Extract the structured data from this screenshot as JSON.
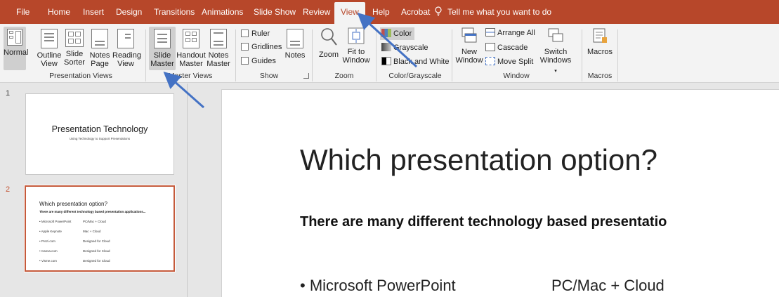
{
  "colors": {
    "accent": "#b7472a",
    "arrow": "#4472c4",
    "selection": "#c55a3b"
  },
  "menu": {
    "tabs": [
      "File",
      "Home",
      "Insert",
      "Design",
      "Transitions",
      "Animations",
      "Slide Show",
      "Review",
      "View",
      "Help",
      "Acrobat"
    ],
    "active_tab": "View",
    "tell_me": "Tell me what you want to do"
  },
  "ribbon": {
    "presentation_views": {
      "label": "Presentation Views",
      "normal": "Normal",
      "outline": [
        "Outline",
        "View"
      ],
      "sorter": [
        "Slide",
        "Sorter"
      ],
      "notes_page": [
        "Notes",
        "Page"
      ],
      "reading": [
        "Reading",
        "View"
      ]
    },
    "master_views": {
      "label": "Master Views",
      "slide_master": [
        "Slide",
        "Master"
      ],
      "handout_master": [
        "Handout",
        "Master"
      ],
      "notes_master": [
        "Notes",
        "Master"
      ]
    },
    "show": {
      "label": "Show",
      "ruler": "Ruler",
      "gridlines": "Gridlines",
      "guides": "Guides",
      "notes": "Notes"
    },
    "zoom": {
      "label": "Zoom",
      "zoom": "Zoom",
      "fit": [
        "Fit to",
        "Window"
      ]
    },
    "color": {
      "label": "Color/Grayscale",
      "color": "Color",
      "grayscale": "Grayscale",
      "bw": "Black and White"
    },
    "window": {
      "label": "Window",
      "new_window": [
        "New",
        "Window"
      ],
      "arrange_all": "Arrange All",
      "cascade": "Cascade",
      "move_split": "Move Split",
      "switch": [
        "Switch",
        "Windows"
      ]
    },
    "macros": {
      "label": "Macros",
      "macros": "Macros"
    }
  },
  "thumbnails": [
    {
      "number": "1",
      "title": "Presentation Technology",
      "subtitle": "Using Technology to Support Presentations"
    },
    {
      "number": "2",
      "title": "Which presentation option?",
      "subtitle": "There are many different technology based presentation applications...",
      "rows": [
        [
          "• Microsoft PowerPoint",
          "PC/Mac + Cloud"
        ],
        [
          "• Apple Keynote",
          "Mac + Cloud"
        ],
        [
          "• Prezi.com",
          "Designed for Cloud"
        ],
        [
          "• Canva.com",
          "Designed for Cloud"
        ],
        [
          "• Visme.com",
          "Designed for Cloud"
        ]
      ]
    }
  ],
  "slide": {
    "title": "Which presentation option?",
    "subtitle": "There are many different technology based presentatio",
    "bullet": "• Microsoft PowerPoint",
    "bullet_value": "PC/Mac + Cloud"
  }
}
